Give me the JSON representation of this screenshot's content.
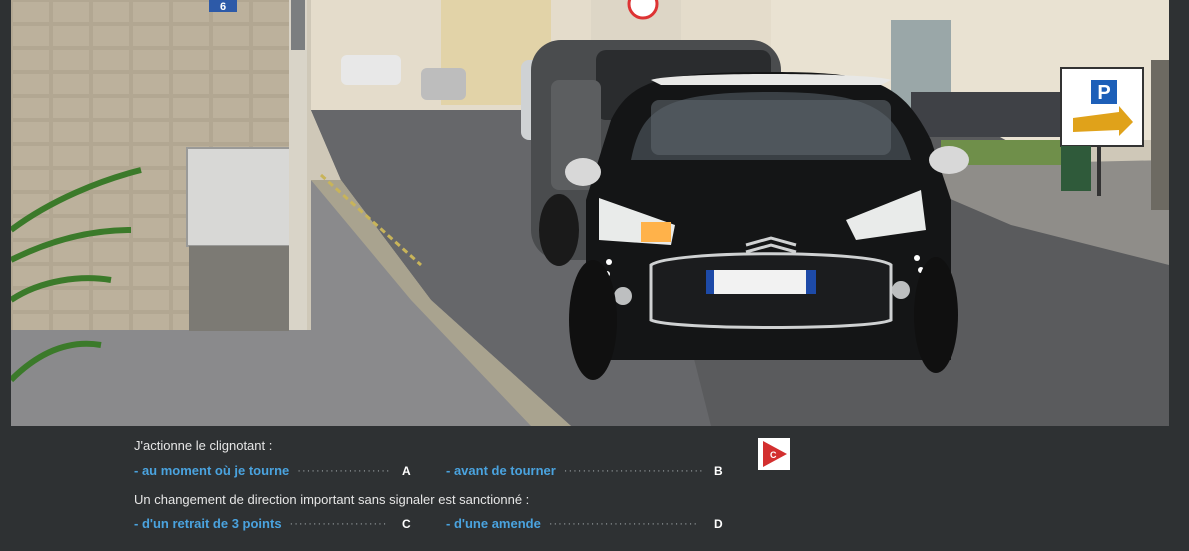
{
  "photo": {
    "street_number": "6",
    "parking_sign": "P"
  },
  "questions": [
    {
      "text": "J'actionne le clignotant :",
      "answers": [
        {
          "label": "- au moment où je tourne",
          "letter": "A"
        },
        {
          "label": "- avant de tourner",
          "letter": "B"
        }
      ]
    },
    {
      "text": "Un changement de direction important sans signaler est sanctionné :",
      "answers": [
        {
          "label": "- d'un retrait de 3 points",
          "letter": "C"
        },
        {
          "label": "- d'une amende",
          "letter": "D"
        }
      ]
    }
  ],
  "badge": {
    "letter": "C",
    "icon": "play-correction-icon",
    "color": "#d32f2f"
  },
  "colors": {
    "answer_text": "#4aa3df",
    "panel_bg": "#2e3133"
  }
}
